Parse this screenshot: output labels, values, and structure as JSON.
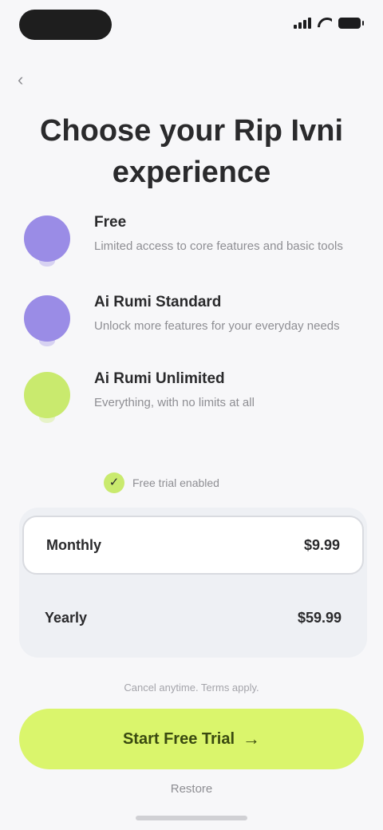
{
  "status_bar": {
    "time": "",
    "signal_icon": "signal-icon",
    "wifi_icon": "wifi-icon",
    "battery_icon": "battery-icon"
  },
  "nav": {
    "back_icon": "back-arrow-icon"
  },
  "header": {
    "title": "Choose your Rip Ivni experience"
  },
  "features": [
    {
      "icon": "feature-icon",
      "color": "#9a8ce6",
      "title": "Free",
      "description": "Limited access to core features and basic tools"
    },
    {
      "icon": "feature-icon",
      "color": "#9a8ce6",
      "title": "Ai Rumi Standard",
      "description": "Unlock more features for your everyday needs"
    },
    {
      "icon": "feature-icon",
      "color": "#c9ea6e",
      "title": "Ai Rumi Unlimited",
      "description": "Everything, with no limits at all"
    }
  ],
  "trial": {
    "label": "Free trial enabled"
  },
  "plans": [
    {
      "name": "Monthly",
      "price": "$9.99"
    },
    {
      "name": "Yearly",
      "price": "$59.99"
    }
  ],
  "fine_print": "Cancel anytime. Terms apply.",
  "cta": {
    "label": "Start Free Trial",
    "arrow_icon": "arrow-right-icon"
  },
  "secondary": {
    "label": "Restore"
  },
  "colors": {
    "accent": "#daf56c",
    "purple": "#9a8ce6",
    "background": "#f7f7f9"
  }
}
